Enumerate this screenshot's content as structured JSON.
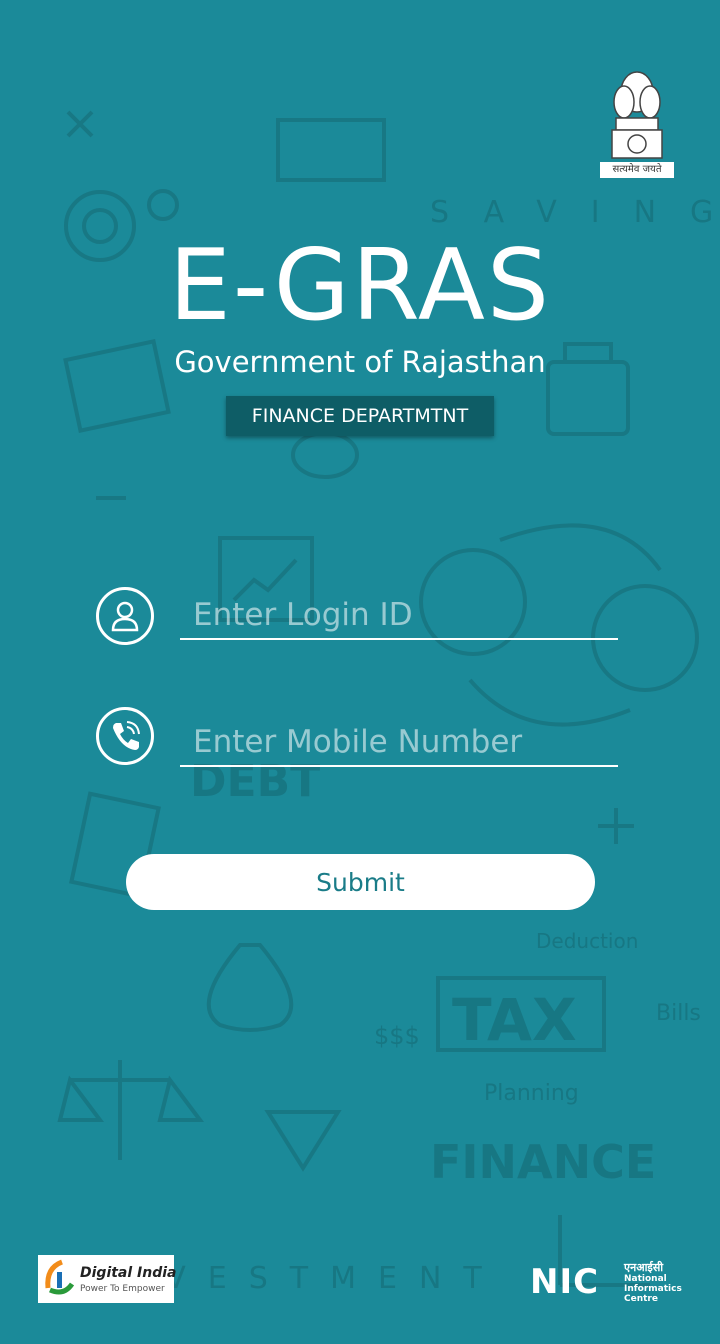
{
  "header": {
    "app_title": "E-GRAS",
    "subtitle": "Government of Rajasthan",
    "department": "FINANCE DEPARTMTNT",
    "emblem_motto": "सत्यमेव जयते"
  },
  "form": {
    "login_placeholder": "Enter Login ID",
    "login_value": "",
    "mobile_placeholder": "Enter Mobile Number",
    "mobile_value": "",
    "submit_label": "Submit"
  },
  "background_text": {
    "saving": "SAVING",
    "debt": "DEBT",
    "tax": "TAX",
    "deduction": "Deduction",
    "bills": "Bills",
    "planning": "Planning",
    "dollars": "$$$",
    "finance": "FINANCE",
    "investment": "INVESTMENT"
  },
  "footer": {
    "digital_india_name": "Digital India",
    "digital_india_tagline": "Power To Empower",
    "nic_mark": "NIC",
    "nic_hindi": "एनआईसी",
    "nic_full": "National Informatics Centre"
  },
  "colors": {
    "background": "#1b8a99",
    "badge": "#0e5d66",
    "button_text": "#1a7c88"
  },
  "icons": [
    "user-icon",
    "phone-icon",
    "state-emblem-icon",
    "digital-india-icon"
  ]
}
